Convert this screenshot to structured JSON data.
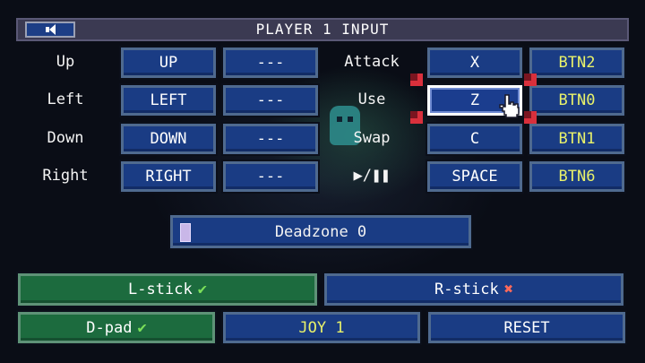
{
  "header": {
    "title": "PLAYER 1 INPUT"
  },
  "directions": [
    {
      "label": "Up",
      "primary": "UP",
      "secondary": "---"
    },
    {
      "label": "Left",
      "primary": "LEFT",
      "secondary": "---"
    },
    {
      "label": "Down",
      "primary": "DOWN",
      "secondary": "---"
    },
    {
      "label": "Right",
      "primary": "RIGHT",
      "secondary": "---"
    }
  ],
  "actions": [
    {
      "label": "Attack",
      "key": "X",
      "button": "BTN2"
    },
    {
      "label": "Use",
      "key": "Z",
      "button": "BTN0"
    },
    {
      "label": "Swap",
      "key": "C",
      "button": "BTN1"
    },
    {
      "label": "▶/❚❚",
      "key": "SPACE",
      "button": "BTN6"
    }
  ],
  "deadzone": {
    "label": "Deadzone 0",
    "value": 0
  },
  "sticks": {
    "left": {
      "label": "L-stick",
      "enabled": true,
      "mark": "✔"
    },
    "right": {
      "label": "R-stick",
      "enabled": false,
      "mark": "✖"
    }
  },
  "bottom": {
    "dpad": {
      "label": "D-pad",
      "mark": "✔"
    },
    "joy": {
      "label": "JOY 1"
    },
    "reset": {
      "label": "RESET"
    }
  },
  "icons": {
    "back": "speaker-back-icon",
    "pointer": "hand-cursor-icon"
  },
  "colors": {
    "button_fill": "#1a3c84",
    "green_fill": "#1c6b3e",
    "selection": "#d9303c",
    "gamepad_text": "#e9f26a"
  }
}
